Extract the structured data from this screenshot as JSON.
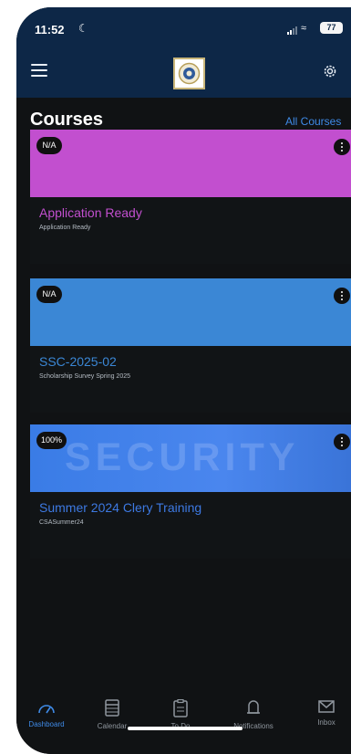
{
  "status_bar": {
    "time": "11:52",
    "battery": "77"
  },
  "header": {
    "title": "Courses",
    "all_courses_label": "All Courses"
  },
  "courses": [
    {
      "badge": "N/A",
      "title": "Application Ready",
      "subtitle": "Application Ready",
      "banner_color": "#c24fcf",
      "title_color": "#c24fcf"
    },
    {
      "badge": "N/A",
      "title": "SSC-2025-02",
      "subtitle": "Scholarship Survey Spring 2025",
      "banner_color": "#3b87d5",
      "title_color": "#3b87d5"
    },
    {
      "badge": "100%",
      "title": "Summer 2024 Clery Training",
      "subtitle": "CSASummer24",
      "banner_color": "#3d79e2",
      "title_color": "#3d79e2",
      "banner_text": "SECURITY"
    }
  ],
  "tabs": [
    {
      "label": "Dashboard",
      "icon": "dashboard-icon",
      "active": true
    },
    {
      "label": "Calendar",
      "icon": "calendar-icon",
      "active": false
    },
    {
      "label": "To Do",
      "icon": "todo-icon",
      "active": false
    },
    {
      "label": "Notifications",
      "icon": "bell-icon",
      "active": false
    },
    {
      "label": "Inbox",
      "icon": "inbox-icon",
      "active": false
    }
  ],
  "colors": {
    "header": "#0d2747",
    "background": "#101214",
    "active_tab": "#3f8be8",
    "inactive_tab": "#8f969e",
    "link": "#3f8be8"
  }
}
